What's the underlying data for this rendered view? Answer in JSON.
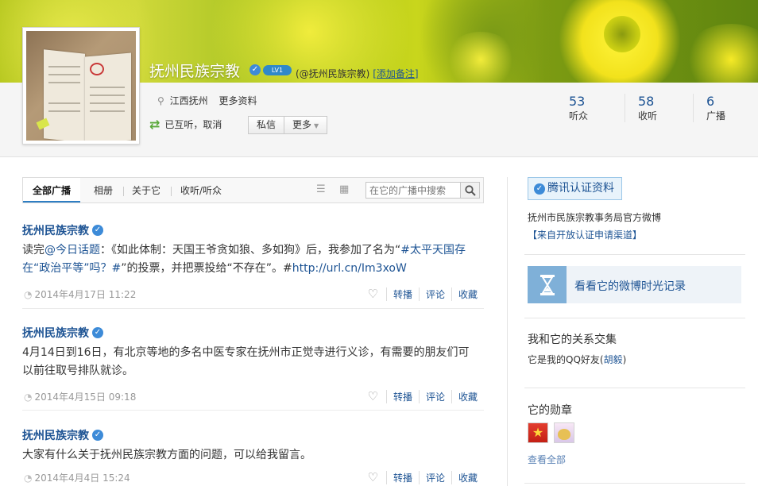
{
  "profile": {
    "name": "抚州民族宗教",
    "level_badge": "LV1",
    "handle": "(@抚州民族宗教)",
    "add_note": "[添加备注]",
    "location": "江西抚州",
    "more_info": "更多资料",
    "mutual_status": "已互听，取消",
    "message_btn": "私信",
    "more_btn": "更多"
  },
  "stats": [
    {
      "value": "53",
      "label": "听众"
    },
    {
      "value": "58",
      "label": "收听"
    },
    {
      "value": "6",
      "label": "广播"
    }
  ],
  "tabs": {
    "all": "全部广播",
    "album": "相册",
    "about": "关于它",
    "follow": "收听/听众",
    "search_placeholder": "在它的广播中搜索"
  },
  "posts": [
    {
      "author": "抚州民族宗教",
      "text_prefix": "读完",
      "text_link1": "@今日话题",
      "text_mid1": "：《如此体制：天国王爷贪如狼、多如狗》后，我参加了名为“",
      "text_link2": "#太平天国存在“政治平等”吗？#",
      "text_mid2": "”的投票，并把票投给“不存在”。#",
      "text_link3": "http://url.cn/Im3xoW",
      "time": "2014年4月17日 11:22"
    },
    {
      "author": "抚州民族宗教",
      "text": "4月14日到16日，有北京等地的多名中医专家在抚州市正觉寺进行义诊，有需要的朋友们可以前往取号排队就诊。",
      "time": "2014年4月15日 09:18"
    },
    {
      "author": "抚州民族宗教",
      "text": "大家有什么关于抚州民族宗教方面的问题，可以给我留言。",
      "time": "2014年4月4日 15:24"
    }
  ],
  "actions": {
    "repost": "转播",
    "comment": "评论",
    "favorite": "收藏"
  },
  "sidebar": {
    "auth_badge": "腾讯认证资料",
    "auth_desc": "抚州市民族宗教事务局官方微博",
    "auth_channel": "【来自开放认证申请渠道】",
    "timeline_link": "看看它的微博时光记录",
    "relation_title": "我和它的关系交集",
    "relation_desc_prefix": "它是我的QQ好友(",
    "relation_name": "胡毅",
    "relation_desc_suffix": ")",
    "medal_title": "它的勋章",
    "see_all": "查看全部"
  },
  "colors": {
    "link": "#1e5494",
    "verify": "#3d8bd8"
  }
}
